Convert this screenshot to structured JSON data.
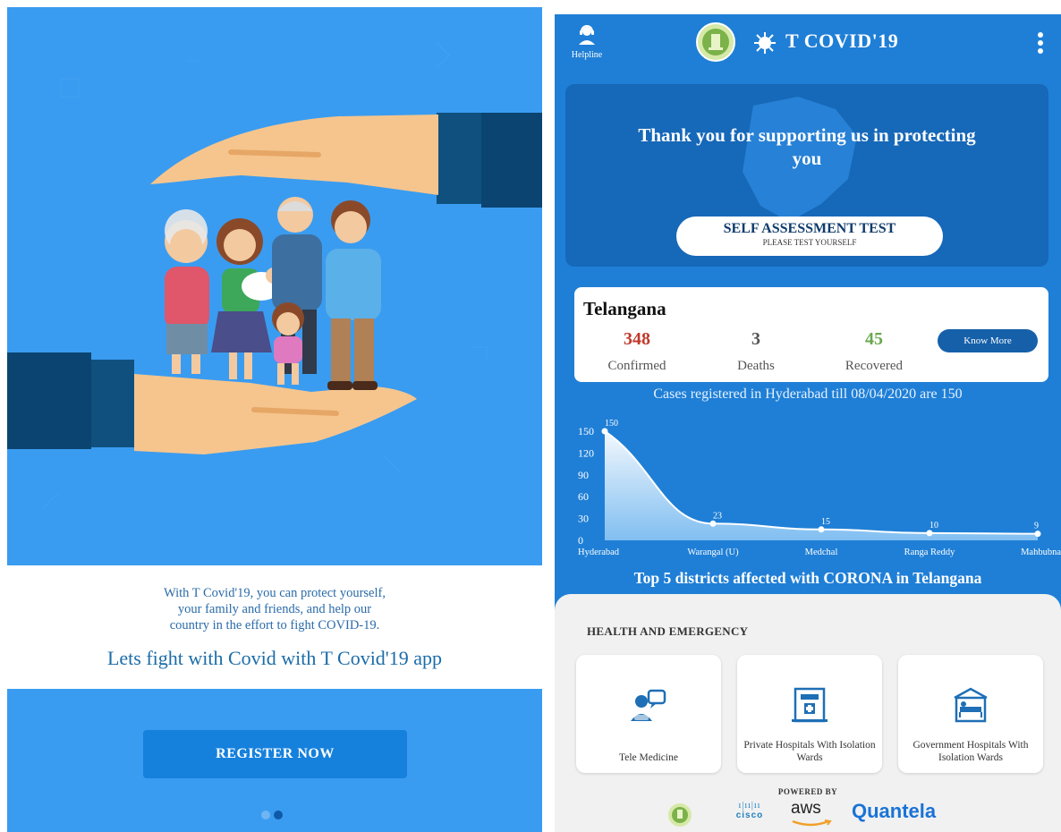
{
  "onboarding": {
    "description_lines": [
      "With T Covid'19, you can protect yourself,",
      "your family and friends, and help our",
      "country in the effort to fight COVID-19."
    ],
    "tagline": "Lets fight with Covid with T Covid'19 app",
    "register_button": "REGISTER NOW",
    "pager": {
      "pages": 2,
      "active": 2
    }
  },
  "app": {
    "title": "T COVID'19",
    "helpline_label": "Helpline",
    "banner": {
      "message": "Thank you for supporting us in protecting you",
      "self_test_title": "SELF ASSESSMENT TEST",
      "self_test_subtitle": "PLEASE TEST YOURSELF"
    },
    "stats": {
      "state": "Telangana",
      "confirmed": {
        "value": "348",
        "label": "Confirmed",
        "color": "#c0392b"
      },
      "deaths": {
        "value": "3",
        "label": "Deaths",
        "color": "#555555"
      },
      "recovered": {
        "value": "45",
        "label": "Recovered",
        "color": "#6aa84f"
      },
      "know_more": "Know More"
    },
    "cases_note": "Cases registered in Hyderabad till 08/04/2020 are 150",
    "chart_caption": "Top 5 districts affected with CORONA in Telangana",
    "health": {
      "title": "HEALTH AND EMERGENCY",
      "cards": [
        {
          "label": "Tele Medicine",
          "icon": "doctor-chat-icon"
        },
        {
          "label": "Private Hospitals With Isolation Wards",
          "icon": "hospital-building-icon"
        },
        {
          "label": "Government Hospitals With Isolation Wards",
          "icon": "hospital-bed-icon"
        }
      ]
    },
    "powered_by": {
      "label": "POWERED BY",
      "partners": [
        "cisco",
        "aws",
        "Quantela"
      ]
    }
  },
  "chart_data": {
    "type": "area",
    "categories": [
      "Hyderabad",
      "Warangal (U)",
      "Medchal",
      "Ranga Reddy",
      "Mahbubna"
    ],
    "values": [
      150,
      23,
      15,
      10,
      9
    ],
    "yticks": [
      0,
      30,
      60,
      90,
      120,
      150
    ],
    "ylim": [
      0,
      150
    ],
    "title": "Top 5 districts affected with CORONA in Telangana"
  }
}
